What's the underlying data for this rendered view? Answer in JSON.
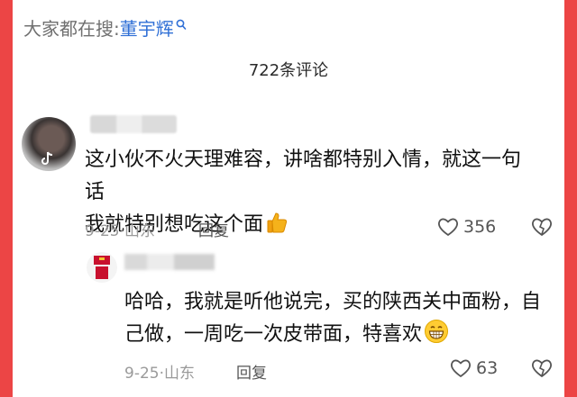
{
  "search": {
    "prefix": "大家都在搜:",
    "term": "董宇辉"
  },
  "comments": {
    "count_label": "722条评论"
  },
  "comment": {
    "line1": "这小伙不火天理难容，讲啥都特别入情，就这一句话",
    "line2": "我就特别想吃这个面",
    "date_location": "9-25·山东",
    "reply_label": "回复",
    "likes": "356",
    "emoji": "thumbs-up-icon"
  },
  "reply": {
    "line1": "哈哈，我就是听他说完，买的陕西关中面粉，自",
    "line2": "己做，一周吃一次皮带面，特喜欢",
    "date_location": "9-25·山东",
    "reply_label": "回复",
    "likes": "63",
    "emoji": "grinning-face-icon"
  },
  "colors": {
    "frame": "#ec4545",
    "link": "#2f6fd6",
    "meta": "#9a9a9a"
  }
}
